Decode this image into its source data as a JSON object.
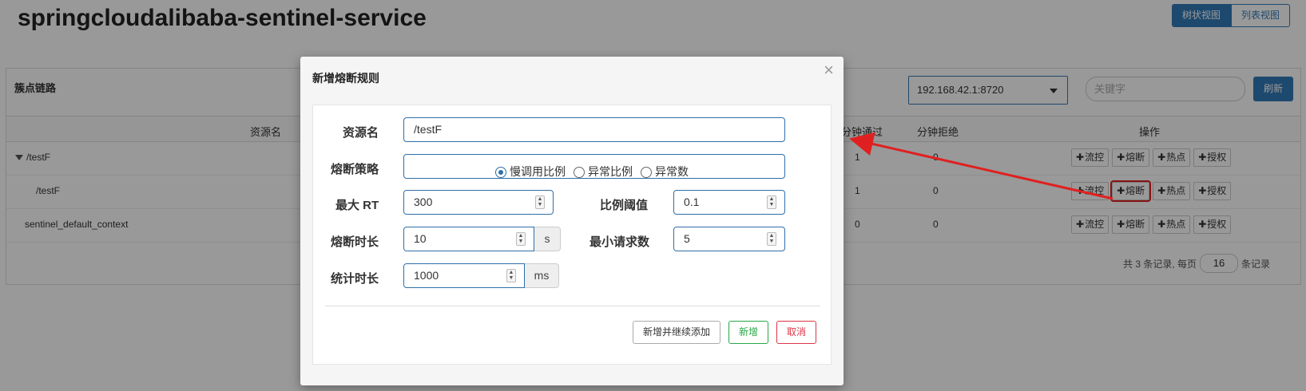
{
  "page": {
    "title": "springcloudalibaba-sentinel-service"
  },
  "view_toggle": {
    "tree": "树状视图",
    "list": "列表视图"
  },
  "panel": {
    "title": "簇点链路",
    "machine": "192.168.42.1:8720",
    "keyword_placeholder": "关键字",
    "refresh": "刷新"
  },
  "table": {
    "headers": {
      "resource": "资源名",
      "pass_qps": "分钟通过",
      "block_qps": "分钟拒绝",
      "ops": "操作"
    },
    "rows": [
      {
        "name": "/testF",
        "pass": "1",
        "block": "0"
      },
      {
        "name": "/testF",
        "pass": "1",
        "block": "0"
      },
      {
        "name": "sentinel_default_context",
        "pass": "0",
        "block": "0"
      }
    ],
    "op_buttons": {
      "flow": "流控",
      "degrade": "熔断",
      "hot": "热点",
      "auth": "授权"
    }
  },
  "pager": {
    "prefix": "共 3 条记录, 每页",
    "page_size": "16",
    "suffix": "条记录"
  },
  "modal": {
    "title": "新增熔断规则",
    "close": "×",
    "resource_label": "资源名",
    "resource_value": "/testF",
    "strategy_label": "熔断策略",
    "strategy_options": [
      "慢调用比例",
      "异常比例",
      "异常数"
    ],
    "strategy_selected": "慢调用比例",
    "max_rt_label": "最大 RT",
    "max_rt_value": "300",
    "ratio_label": "比例阈值",
    "ratio_value": "0.1",
    "duration_label": "熔断时长",
    "duration_value": "10",
    "duration_unit": "s",
    "min_req_label": "最小请求数",
    "min_req_value": "5",
    "stat_label": "统计时长",
    "stat_value": "1000",
    "stat_unit": "ms",
    "btn_add_continue": "新增并继续添加",
    "btn_add": "新增",
    "btn_cancel": "取消"
  },
  "colors": {
    "primary": "#337ab7",
    "success": "#28a745",
    "danger": "#dc3545",
    "annotation": "#e02020"
  }
}
